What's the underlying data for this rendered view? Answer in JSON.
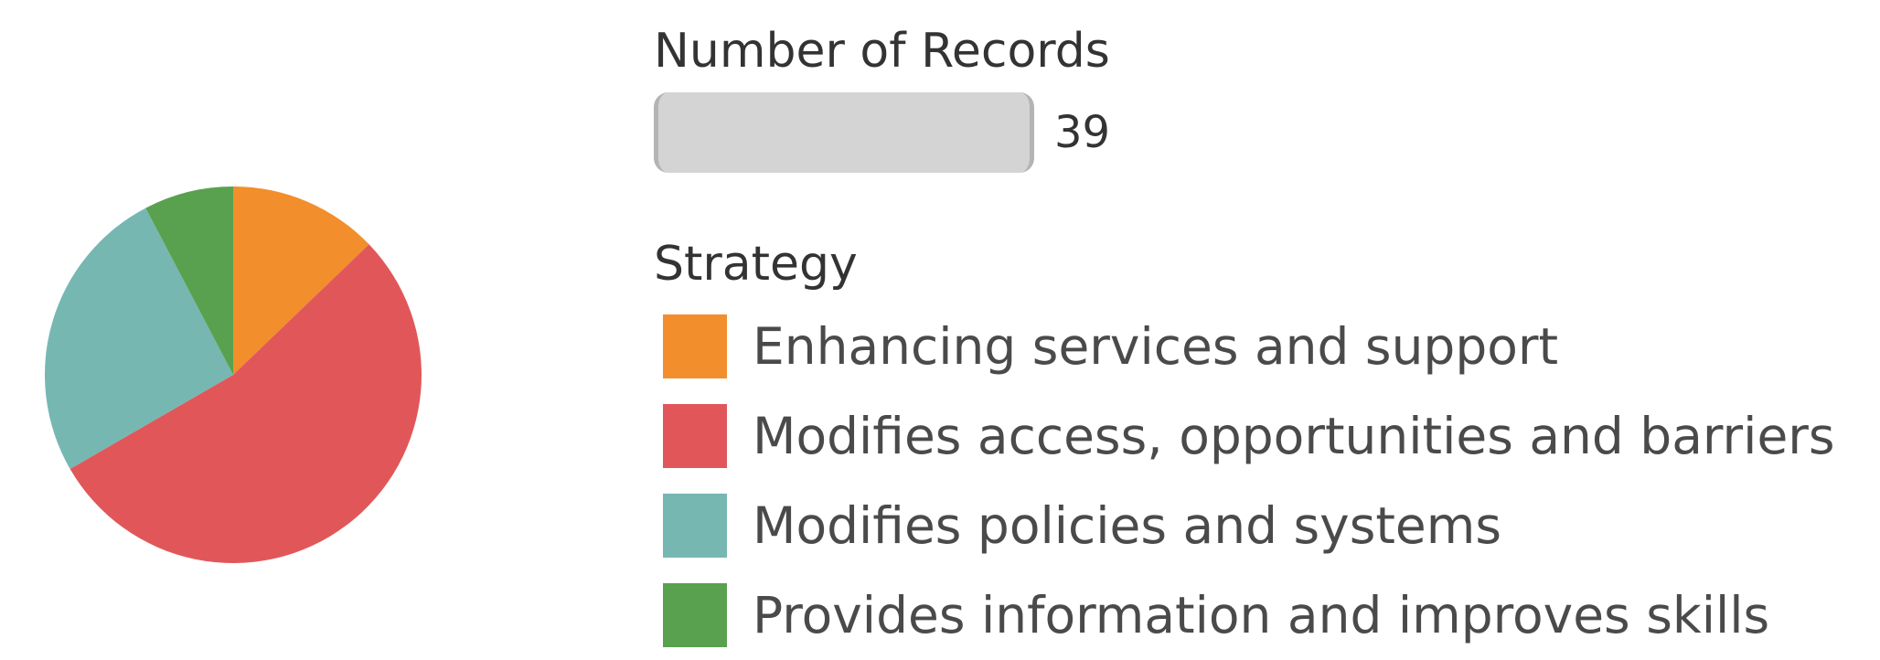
{
  "chart_data": {
    "type": "pie",
    "size_legend": {
      "title": "Number of Records",
      "value": "39"
    },
    "legend_title": "Strategy",
    "slices": [
      {
        "label": "Enhancing services and support",
        "value": 5,
        "color": "#f28e2b"
      },
      {
        "label": "Modifies access, opportunities and barriers",
        "value": 21,
        "color": "#e15759"
      },
      {
        "label": "Modifies policies and systems",
        "value": 10,
        "color": "#76b7b2"
      },
      {
        "label": "Provides information and improves skills",
        "value": 3,
        "color": "#59a14f"
      }
    ],
    "total": 39
  }
}
